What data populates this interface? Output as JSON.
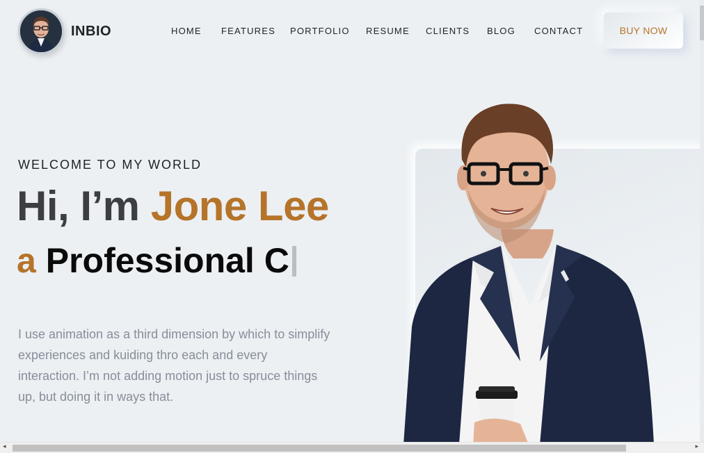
{
  "header": {
    "brand": "INBIO",
    "nav": [
      "HOME",
      "FEATURES",
      "PORTFOLIO",
      "RESUME",
      "CLIENTS",
      "BLOG",
      "CONTACT"
    ],
    "cta": "BUY NOW"
  },
  "hero": {
    "welcome": "WELCOME TO MY WORLD",
    "greeting": "Hi, I’m ",
    "name": "Jone Lee",
    "role_prefix": "a",
    "role_text": "Professional C",
    "description": "I use animation as a third dimension by which to simplify experiences and kuiding thro each and every interaction. I’m not adding motion just to spruce things up, but doing it in ways that."
  },
  "colors": {
    "accent": "#b5742a",
    "background": "#ecf0f3",
    "heading": "#3c3e41",
    "body_text": "#878e99"
  },
  "icons": {
    "scroll_left": "◂",
    "scroll_right": "▸"
  }
}
